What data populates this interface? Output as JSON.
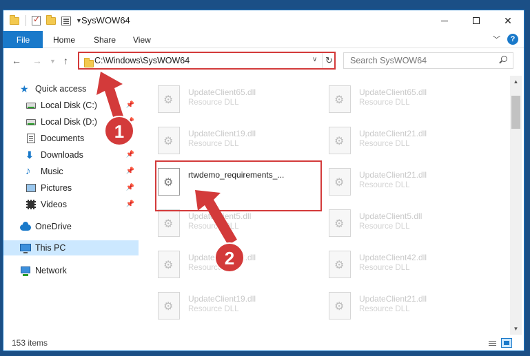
{
  "window": {
    "title": "SysWOW64"
  },
  "ribbon": {
    "file_tab": "File",
    "tabs": [
      "Home",
      "Share",
      "View"
    ]
  },
  "address": {
    "path": "C:\\Windows\\SysWOW64"
  },
  "search": {
    "placeholder": "Search SysWOW64"
  },
  "nav": {
    "quick_access": "Quick access",
    "items": [
      {
        "label": "Local Disk (C:)",
        "icon": "disk-icon"
      },
      {
        "label": "Local Disk (D:)",
        "icon": "disk-icon"
      },
      {
        "label": "Documents",
        "icon": "documents-icon"
      },
      {
        "label": "Downloads",
        "icon": "downloads-icon"
      },
      {
        "label": "Music",
        "icon": "music-icon"
      },
      {
        "label": "Pictures",
        "icon": "pictures-icon"
      },
      {
        "label": "Videos",
        "icon": "videos-icon"
      }
    ],
    "onedrive": "OneDrive",
    "this_pc": "This PC",
    "network": "Network"
  },
  "files": {
    "left": [
      {
        "name": "UpdateClient65.dll",
        "type": "Resource DLL"
      },
      {
        "name": "UpdateClient19.dll",
        "type": "Resource DLL"
      },
      {
        "name": "rtwdemo_requirements_...",
        "type": ""
      },
      {
        "name": "UpdateClient5.dll",
        "type": "Resource DLL"
      },
      {
        "name": "UpdateClient42.dll",
        "type": "Resource DLL"
      },
      {
        "name": "UpdateClient19.dll",
        "type": "Resource DLL"
      }
    ],
    "right": [
      {
        "name": "UpdateClient65.dll",
        "type": "Resource DLL"
      },
      {
        "name": "UpdateClient21.dll",
        "type": "Resource DLL"
      },
      {
        "name": "UpdateClient21.dll",
        "type": "Resource DLL"
      },
      {
        "name": "UpdateClient5.dll",
        "type": "Resource DLL"
      },
      {
        "name": "UpdateClient42.dll",
        "type": "Resource DLL"
      },
      {
        "name": "UpdateClient21.dll",
        "type": "Resource DLL"
      }
    ]
  },
  "status": {
    "count": "153 items"
  },
  "annotations": {
    "step1": "1",
    "step2": "2",
    "color": "#d33a3a"
  }
}
